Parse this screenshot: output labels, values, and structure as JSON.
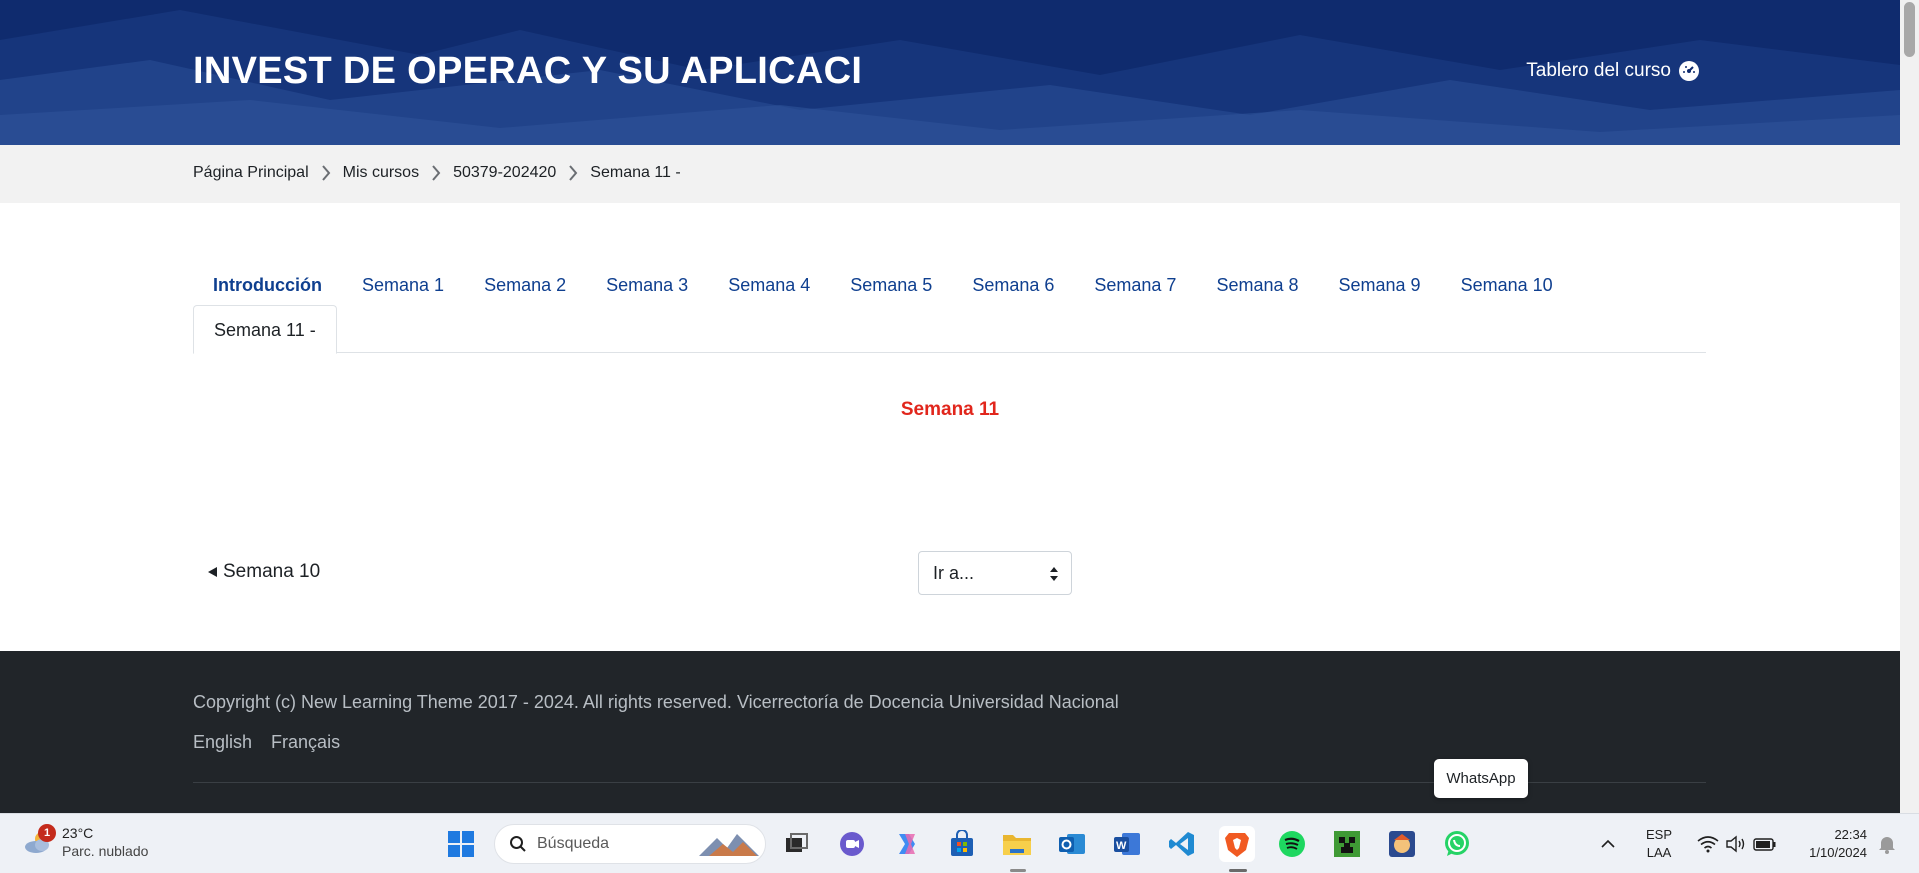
{
  "header": {
    "course_title": "INVEST DE OPERAC Y SU APLICACI",
    "dashboard_link": "Tablero del curso"
  },
  "breadcrumb": [
    "Página Principal",
    "Mis cursos",
    "50379-202420",
    "Semana 11 -"
  ],
  "tabs": {
    "row1": [
      "Introducción",
      "Semana 1",
      "Semana 2",
      "Semana 3",
      "Semana 4",
      "Semana 5",
      "Semana 6",
      "Semana 7",
      "Semana 8",
      "Semana 9",
      "Semana 10"
    ],
    "active": "Semana 11 -"
  },
  "section": {
    "title": "Semana 11"
  },
  "navigation": {
    "prev_label": "Semana 10",
    "jump_label": "Ir a..."
  },
  "footer": {
    "copyright": "Copyright (c) New Learning Theme 2017 - 2024. All rights reserved. Vicerrectoría de Docencia Universidad Nacional",
    "languages": [
      "English",
      "Français"
    ]
  },
  "tooltip": {
    "text": "WhatsApp"
  },
  "taskbar": {
    "weather": {
      "temp": "23°C",
      "condition": "Parc. nublado",
      "badge": "1"
    },
    "search_placeholder": "Búsqueda",
    "pinned": [
      "windows-start",
      "task-view",
      "teams-chat",
      "copilot",
      "microsoft-store",
      "file-explorer",
      "outlook",
      "word",
      "vscode",
      "brave",
      "spotify",
      "minecraft",
      "game",
      "whatsapp"
    ],
    "input_lang": {
      "line1": "ESP",
      "line2": "LAA"
    },
    "clock": {
      "time": "22:34",
      "date": "1/10/2024"
    }
  },
  "colors": {
    "header_bg": "#0f2b6e",
    "link": "#0f3f8f",
    "section_title": "#e1261c",
    "footer_bg": "#212529"
  }
}
